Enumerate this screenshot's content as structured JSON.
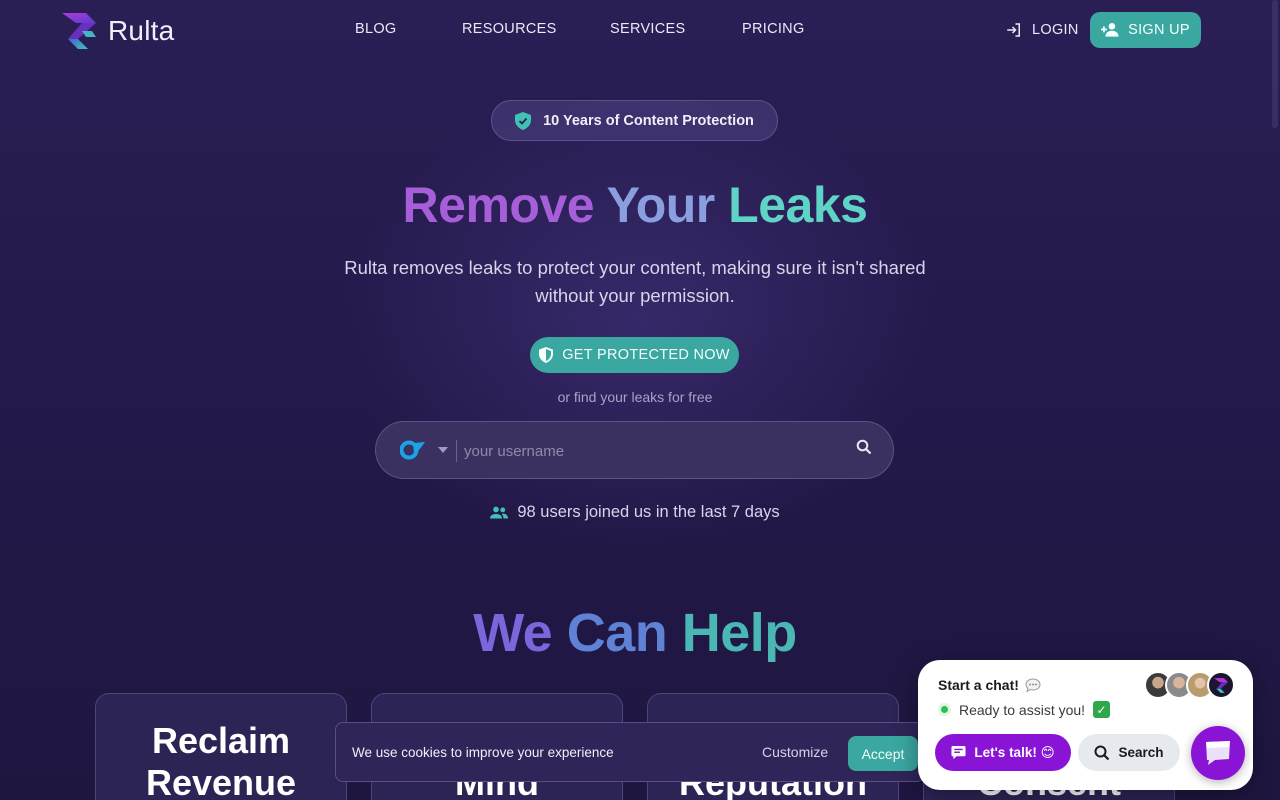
{
  "brand": {
    "name": "Rulta"
  },
  "nav": {
    "items": [
      "BLOG",
      "RESOURCES",
      "SERVICES",
      "PRICING"
    ],
    "login": "LOGIN",
    "signup": "SIGN UP"
  },
  "hero": {
    "badge": "10 Years of Content Protection",
    "title_words": [
      "Remove",
      "Your",
      "Leaks"
    ],
    "subtitle": "Rulta removes leaks to protect your content, making sure it isn't shared without your permission.",
    "cta": "GET PROTECTED NOW",
    "or_text": "or find your leaks for free",
    "search_placeholder": "your username",
    "users_joined": "98 users joined us in the last 7 days"
  },
  "help": {
    "title_words": [
      "We",
      "Can",
      "Help"
    ],
    "cards": [
      "Reclaim Revenue",
      "Mind",
      "Reputation",
      "Consent"
    ]
  },
  "cookie": {
    "text": "We use cookies to improve your experience",
    "customize": "Customize",
    "accept": "Accept"
  },
  "chat": {
    "title": "Start a chat!",
    "status": "Ready to assist you!",
    "lets_talk": "Let's talk! 😊",
    "search": "Search"
  },
  "colors": {
    "accent": "#3aa7a0",
    "chat_purple": "#8a14d6",
    "background": "#24194b"
  }
}
